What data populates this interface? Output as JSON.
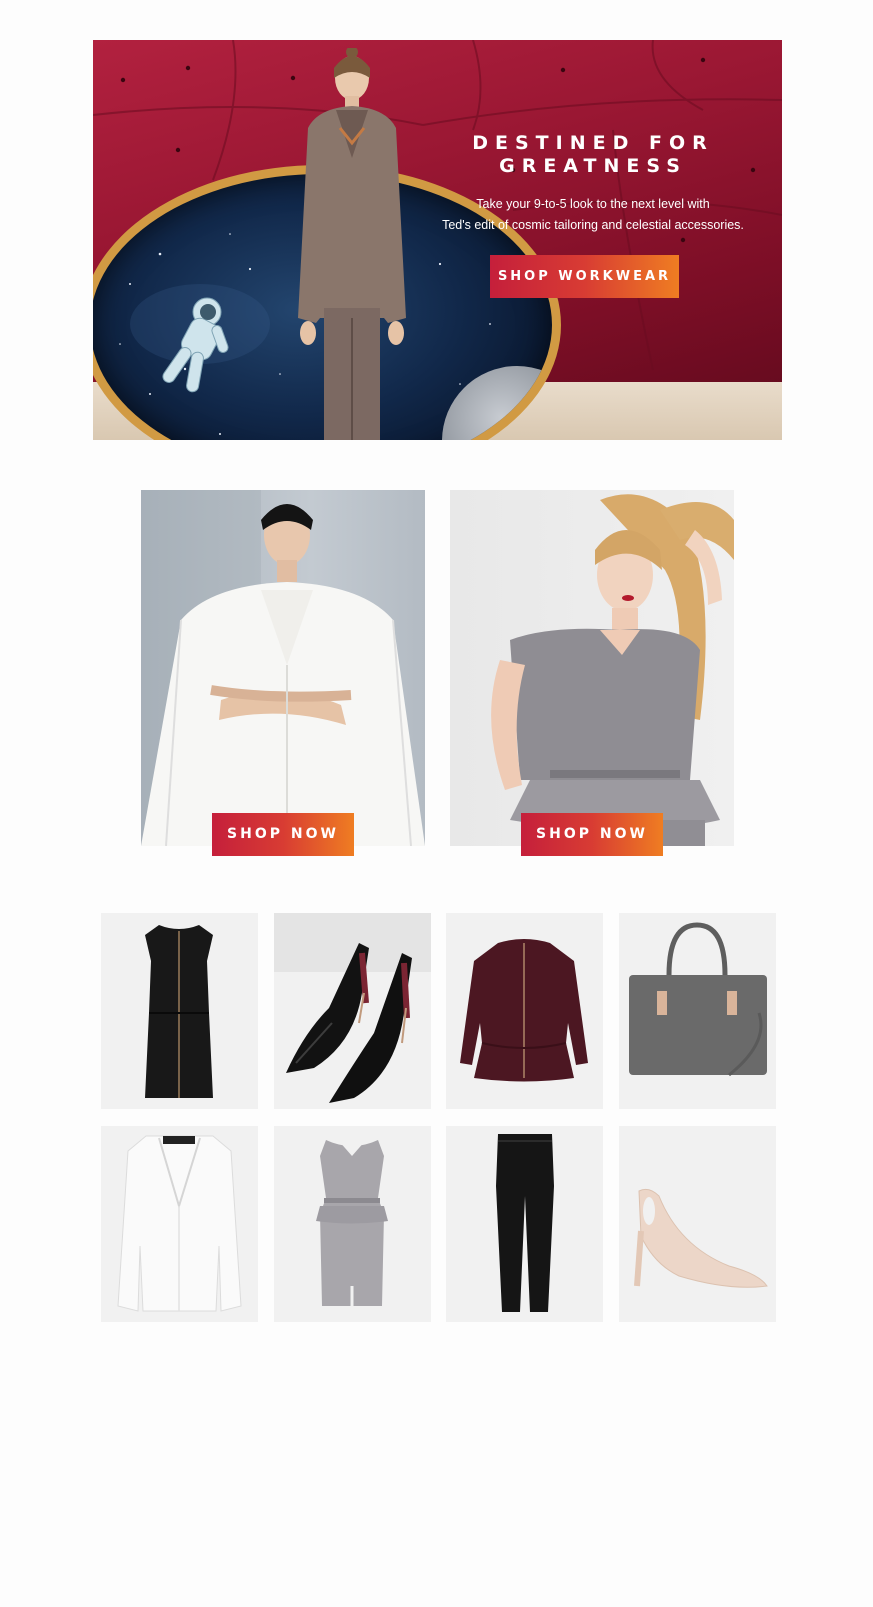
{
  "hero": {
    "headline": "DESTINED FOR\nGREATNESS",
    "subtext": "Take your 9-to-5 look to the next level with\nTed's edit of cosmic tailoring and celestial accessories.",
    "cta_label": "SHOP WORKWEAR"
  },
  "promos": [
    {
      "cta_label": "SHOP NOW",
      "image": "white-cape-jacket-model"
    },
    {
      "cta_label": "SHOP NOW",
      "image": "grey-peplum-dress-model"
    }
  ],
  "products": [
    {
      "image": "black-zip-dress-icon"
    },
    {
      "image": "black-patent-heels-icon"
    },
    {
      "image": "burgundy-peplum-jacket-icon"
    },
    {
      "image": "grey-tote-bag-icon"
    },
    {
      "image": "white-blazer-icon"
    },
    {
      "image": "grey-peplum-dress-icon"
    },
    {
      "image": "black-trousers-icon"
    },
    {
      "image": "nude-cutout-heels-icon"
    }
  ],
  "colors": {
    "cta_start": "#c51f3b",
    "cta_end": "#ef7d22",
    "hero_bg": "#9a1733"
  }
}
